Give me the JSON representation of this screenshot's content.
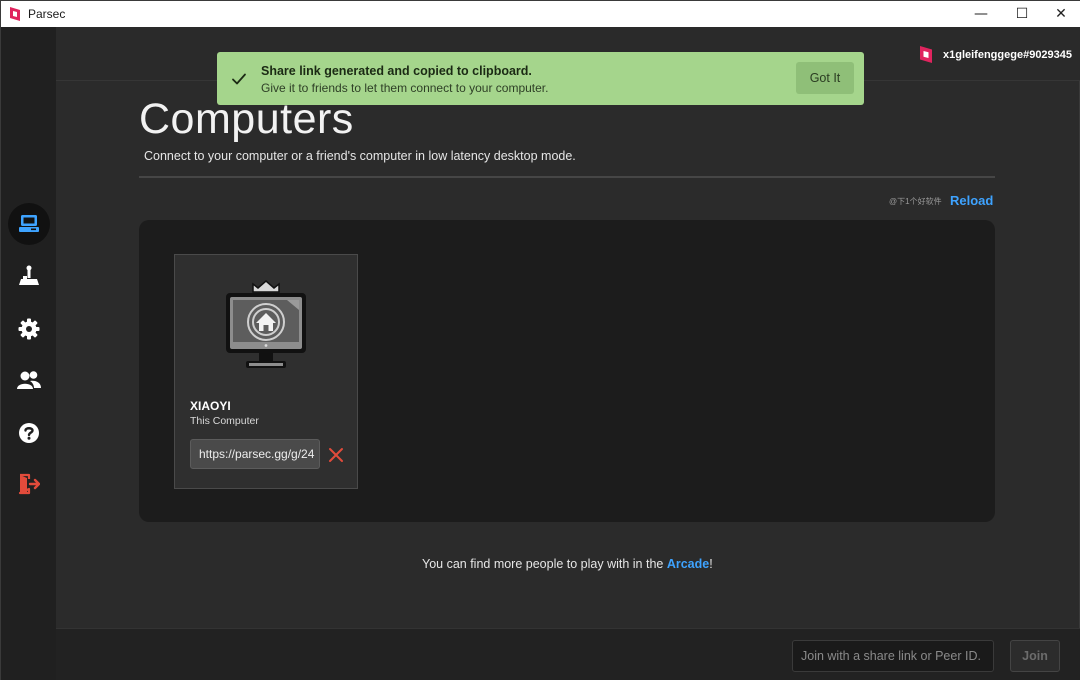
{
  "window": {
    "title": "Parsec",
    "controls": {
      "minimize": "—",
      "maximize": "☐",
      "close": "✕"
    }
  },
  "user": {
    "name": "x1gleifenggege#9029345"
  },
  "toast": {
    "title": "Share link generated and copied to clipboard.",
    "message": "Give it to friends to let them connect to your computer.",
    "button": "Got It"
  },
  "sidebar": {
    "items": [
      {
        "icon": "computer-icon",
        "active": true
      },
      {
        "icon": "joystick-icon",
        "active": false
      },
      {
        "icon": "gear-icon",
        "active": false
      },
      {
        "icon": "friends-icon",
        "active": false
      },
      {
        "icon": "help-icon",
        "active": false
      },
      {
        "icon": "logout-icon",
        "active": false
      }
    ]
  },
  "page": {
    "title": "Computers",
    "subtitle": "Connect to your computer or a friend's computer in low latency desktop mode.",
    "watermark": "@下1个好软件",
    "reload": "Reload"
  },
  "computers": [
    {
      "name": "XIAOYI",
      "label": "This Computer",
      "share_link": "https://parsec.gg/g/24"
    }
  ],
  "arcade": {
    "prefix": "You can find more people to play with in the ",
    "link": "Arcade",
    "suffix": "!"
  },
  "footer": {
    "join_placeholder": "Join with a share link or Peer ID.",
    "join_button": "Join"
  },
  "colors": {
    "accent": "#3ea3ff",
    "toast_bg": "#a5d58c",
    "brand": "#e0245e",
    "danger": "#e24b3b"
  }
}
